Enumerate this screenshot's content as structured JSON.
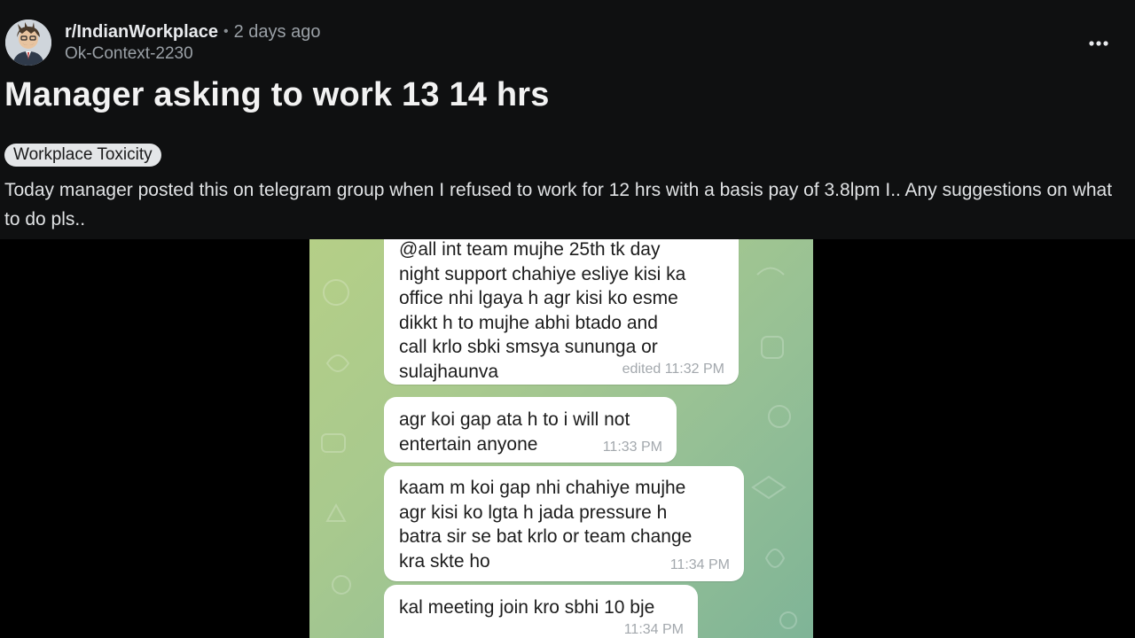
{
  "post": {
    "subreddit": "r/IndianWorkplace",
    "separator": "•",
    "time_ago": "2 days ago",
    "username": "Ok-Context-2230",
    "more_icon": "more-options-icon",
    "title": "Manager asking to work 13 14 hrs",
    "flair": "Workplace Toxicity",
    "body": "Today manager posted this on telegram group when I refused to work for 12 hrs with a basis pay of 3.8lpm I.. Any suggestions on what to do pls.."
  },
  "chat": {
    "messages": [
      {
        "text": "@all int team mujhe 25th tk day\nnight support chahiye esliye kisi ka\noffice nhi lgaya h agr kisi ko esme\ndikkt h to mujhe abhi btado and\ncall krlo sbki smsya sununga or\nsulajhaunva",
        "time": "edited 11:32 PM"
      },
      {
        "text": "agr koi gap ata h to i will not\nentertain anyone",
        "time": "11:33 PM"
      },
      {
        "text": "kaam m koi gap nhi chahiye mujhe\nagr kisi ko lgta h jada pressure h\nbatra sir se bat krlo or team change\nkra skte ho",
        "time": "11:34 PM"
      },
      {
        "text": "kal meeting join kro sbhi 10 bje",
        "time": "11:34 PM"
      }
    ]
  },
  "colors": {
    "header_bg": "#0f1011",
    "page_bg": "#000000",
    "flair_bg": "#e4e6e8",
    "bubble_bg": "#ffffff",
    "chat_green": "#a8c98e"
  }
}
